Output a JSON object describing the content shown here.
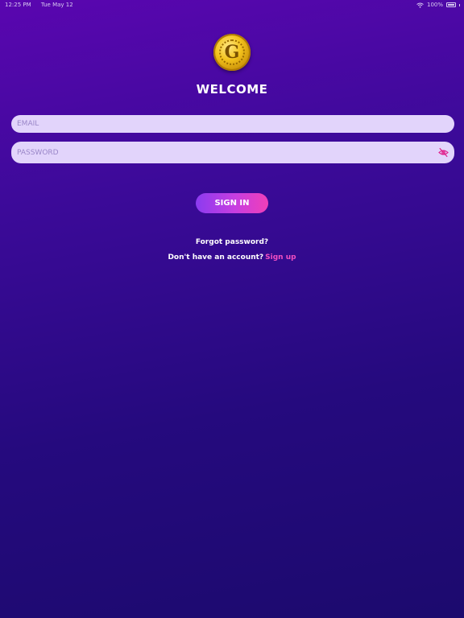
{
  "status_bar": {
    "time": "12:25 PM",
    "date": "Tue May 12",
    "battery": "100%"
  },
  "logo": {
    "letter": "G"
  },
  "title": "WELCOME",
  "email": {
    "placeholder": "EMAIL",
    "value": ""
  },
  "password": {
    "placeholder": "PASSWORD",
    "value": ""
  },
  "sign_in_label": "SIGN IN",
  "forgot_label": "Forgot password?",
  "signup_prompt": "Don't have an account?",
  "signup_label": "Sign up",
  "colors": {
    "accent": "#f24fc3",
    "field_bg": "#e2d4fb",
    "bg_top": "#5a06b0",
    "bg_bottom": "#1c0a6e"
  },
  "icons": {
    "status": [
      "wifi-icon",
      "battery-icon"
    ],
    "password_toggle": "eye-off-icon"
  }
}
